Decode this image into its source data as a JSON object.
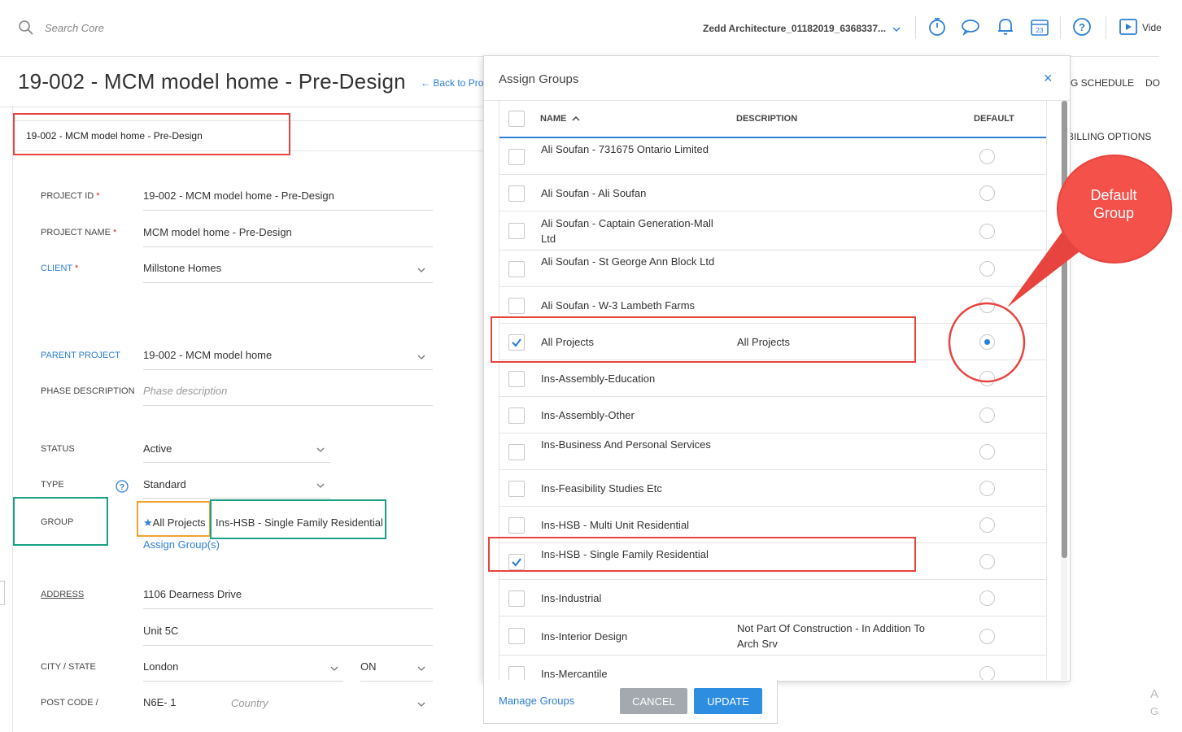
{
  "topbar": {
    "search_placeholder": "Search Core",
    "company": "Zedd Architecture_01182019_6368337...",
    "video_label": "Vide"
  },
  "page": {
    "title": "19-002 - MCM model home - Pre-Design",
    "back_link": "← Back to Pro",
    "right_tab_1": "G SCHEDULE",
    "right_tab_2": "DO",
    "right_tab_3": "BILLING OPTIONS"
  },
  "form": {
    "header": "19-002 - MCM model home - Pre-Design",
    "required_mark": "*",
    "project_id_label": "PROJECT ID",
    "project_id": "19-002 - MCM model home - Pre-Design",
    "project_name_label": "PROJECT NAME",
    "project_name": "MCM model home - Pre-Design",
    "client_label": "CLIENT",
    "client": "Millstone Homes",
    "parent_label": "PARENT PROJECT",
    "parent": "19-002 - MCM model home",
    "phase_label": "PHASE DESCRIPTION",
    "phase_placeholder": "Phase description",
    "status_label": "STATUS",
    "status": "Active",
    "type_label": "TYPE",
    "type": "Standard",
    "group_label": "GROUP",
    "group_default": "All Projects",
    "group_other": "Ins-HSB - Single Family Residential",
    "assign_link": "Assign Group(s)",
    "address_label": "ADDRESS",
    "address_1": "1106 Dearness Drive",
    "address_2": "Unit 5C",
    "city_label": "CITY / STATE",
    "city": "London",
    "state": "ON",
    "postcode_label": "POST CODE /",
    "postcode": "N6E- 1",
    "country_placeholder": "Country"
  },
  "modal": {
    "title": "Assign Groups",
    "close": "×",
    "columns": {
      "name": "NAME",
      "description": "DESCRIPTION",
      "default": "DEFAULT"
    },
    "rows": [
      {
        "name": "Ali Soufan - 731675 Ontario Limited",
        "description": "",
        "checked": false,
        "default": false
      },
      {
        "name": "Ali Soufan - Ali Soufan",
        "description": "",
        "checked": false,
        "default": false
      },
      {
        "name": "Ali Soufan - Captain Generation-Mall Ltd",
        "description": "",
        "checked": false,
        "default": false
      },
      {
        "name": "Ali Soufan - St George Ann Block Ltd",
        "description": "",
        "checked": false,
        "default": false
      },
      {
        "name": "Ali Soufan - W-3 Lambeth Farms",
        "description": "",
        "checked": false,
        "default": false
      },
      {
        "name": "All Projects",
        "description": "All Projects",
        "checked": true,
        "default": true
      },
      {
        "name": "Ins-Assembly-Education",
        "description": "",
        "checked": false,
        "default": false
      },
      {
        "name": "Ins-Assembly-Other",
        "description": "",
        "checked": false,
        "default": false
      },
      {
        "name": "Ins-Business And Personal Services",
        "description": "",
        "checked": false,
        "default": false
      },
      {
        "name": "Ins-Feasibility Studies Etc",
        "description": "",
        "checked": false,
        "default": false
      },
      {
        "name": "Ins-HSB - Multi Unit Residential",
        "description": "",
        "checked": false,
        "default": false
      },
      {
        "name": "Ins-HSB - Single Family Residential",
        "description": "",
        "checked": true,
        "default": false
      },
      {
        "name": "Ins-Industrial",
        "description": "",
        "checked": false,
        "default": false
      },
      {
        "name": "Ins-Interior Design",
        "description": "Not Part Of Construction - In Addition To Arch Srv",
        "checked": false,
        "default": false
      },
      {
        "name": "Ins-Mercantile",
        "description": "",
        "checked": false,
        "default": false
      }
    ],
    "manage_link": "Manage Groups",
    "cancel": "CANCEL",
    "update": "UPDATE"
  },
  "annotation": {
    "callout": "Default Group"
  },
  "corner": {
    "a": "A",
    "g": "G"
  },
  "colors": {
    "accent": "#2d7fd6",
    "annotation_red": "#e8443f",
    "annotation_green": "#19a086",
    "annotation_orange": "#f0a330"
  }
}
